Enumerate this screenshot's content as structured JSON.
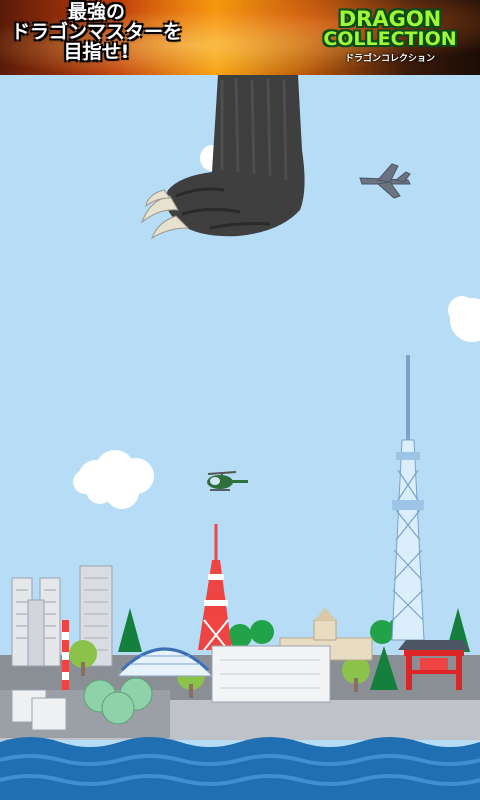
{
  "ad_banner": {
    "line1": "最強の",
    "line2": "ドラゴンマスターを",
    "line3": "目指せ!",
    "logo_line1": "DRAGON",
    "logo_line2": "COLLECTION",
    "logo_sub": "ドラゴンコレクション"
  },
  "scene": {
    "sky_color": "#b7dcf5",
    "sea_color": "#1f6fb2",
    "elements": [
      "dragon-claw",
      "fighter-jet",
      "helicopter",
      "clouds",
      "tokyo-skyline",
      "sea"
    ]
  }
}
